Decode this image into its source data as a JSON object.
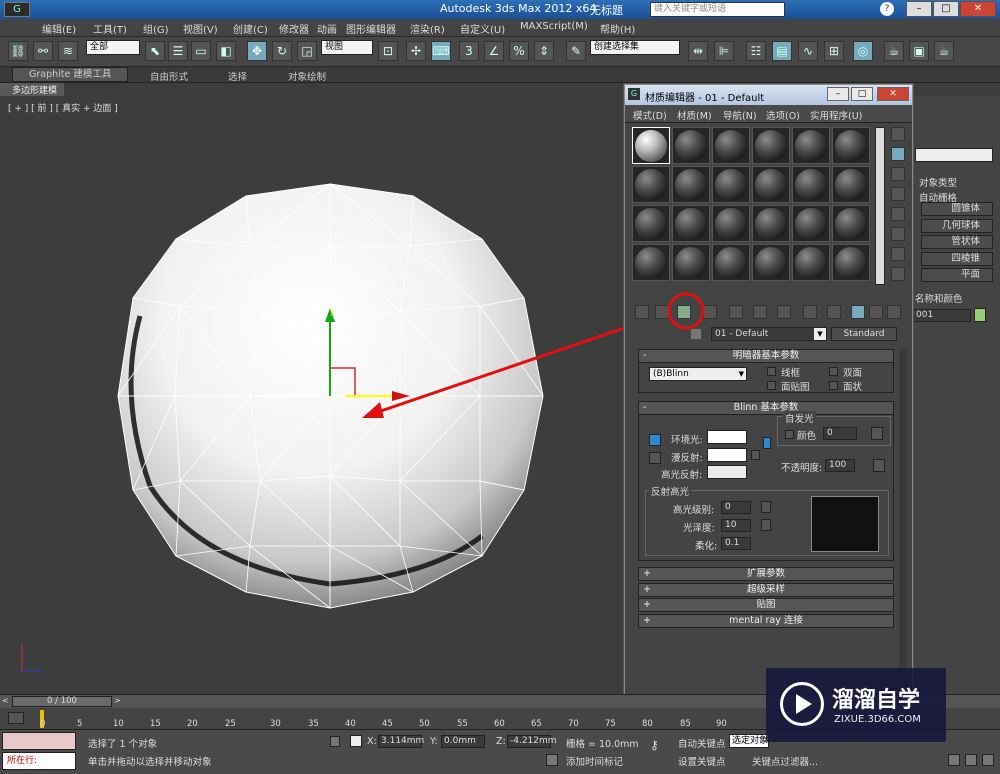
{
  "window": {
    "title": "Autodesk 3ds Max  2012 x64",
    "doc": "无标题",
    "search_placeholder": "键入关键字或短语"
  },
  "menu": [
    "编辑(E)",
    "工具(T)",
    "组(G)",
    "视图(V)",
    "创建(C)",
    "修改器",
    "动画",
    "图形编辑器",
    "渲染(R)",
    "自定义(U)",
    "MAXScript(M)",
    "帮助(H)"
  ],
  "toolbar": {
    "filter_value": "全部",
    "view_value": "视图",
    "selection_set": "创建选择集"
  },
  "ribbon": {
    "tabs": [
      "Graphite 建模工具",
      "自由形式",
      "选择",
      "对象绘制"
    ],
    "subtab": "多边形建模"
  },
  "viewport": {
    "label": "[ + ] [ 前 ] [ 真实 + 边面 ]"
  },
  "material_editor": {
    "title": "材质编辑器 - 01 - Default",
    "menu": [
      "模式(D)",
      "材质(M)",
      "导航(N)",
      "选项(O)",
      "实用程序(U)"
    ],
    "material_name": "01 - Default",
    "material_type": "Standard",
    "shader_rollout": {
      "title": "明暗器基本参数",
      "shader": "(B)Blinn",
      "opt_wire": "线框",
      "opt_2side": "双面",
      "opt_facemap": "面贴图",
      "opt_faceted": "面状"
    },
    "blinn_rollout": {
      "title": "Blinn 基本参数",
      "self_illum": "自发光",
      "color_label": "颜色",
      "color_value": "0",
      "ambient": "环境光:",
      "diffuse": "漫反射:",
      "specular": "高光反射:",
      "opacity_label": "不透明度:",
      "opacity_value": "100",
      "highlights": "反射高光",
      "spec_level": "高光级别:",
      "spec_level_value": "0",
      "gloss": "光泽度:",
      "gloss_value": "10",
      "soften": "柔化:",
      "soften_value": "0.1"
    },
    "collapsed_rollouts": [
      "扩展参数",
      "超级采样",
      "贴图",
      "mental ray 连接"
    ]
  },
  "right_panel": {
    "heading": "对象类型",
    "auto_grid": "自动栅格",
    "items": [
      "圆锥体",
      "几何球体",
      "管状体",
      "四棱锥",
      "平面"
    ],
    "name_color": "名称和颜色",
    "name_value": "001"
  },
  "timeline": {
    "frame": "0 / 100",
    "ticks": [
      "0",
      "5",
      "10",
      "15",
      "20",
      "25",
      "30",
      "35",
      "40",
      "45",
      "50",
      "55",
      "60",
      "65",
      "70",
      "75",
      "80",
      "85",
      "90"
    ]
  },
  "status": {
    "line1": "选择了 1 个对象",
    "line2": "单击并拖动以选择并移动对象",
    "x_label": "X:",
    "x_value": "3.114mm",
    "y_label": "Y:",
    "y_value": "0.0mm",
    "z_label": "Z:",
    "z_value": "-4.212mm",
    "grid": "栅格 = 10.0mm",
    "add_key": "添加时间标记",
    "autokey": "自动关键点",
    "setkey": "设置关键点",
    "selected": "选定对象",
    "filters": "关键点过滤器...",
    "running": "所在行:"
  },
  "watermark": {
    "name": "溜溜自学",
    "url": "ZIXUE.3D66.COM"
  },
  "colors": {
    "annotation": "#e01010",
    "titlebar": "#2e6fb7",
    "viewport_bg": "#3d3d3d"
  }
}
